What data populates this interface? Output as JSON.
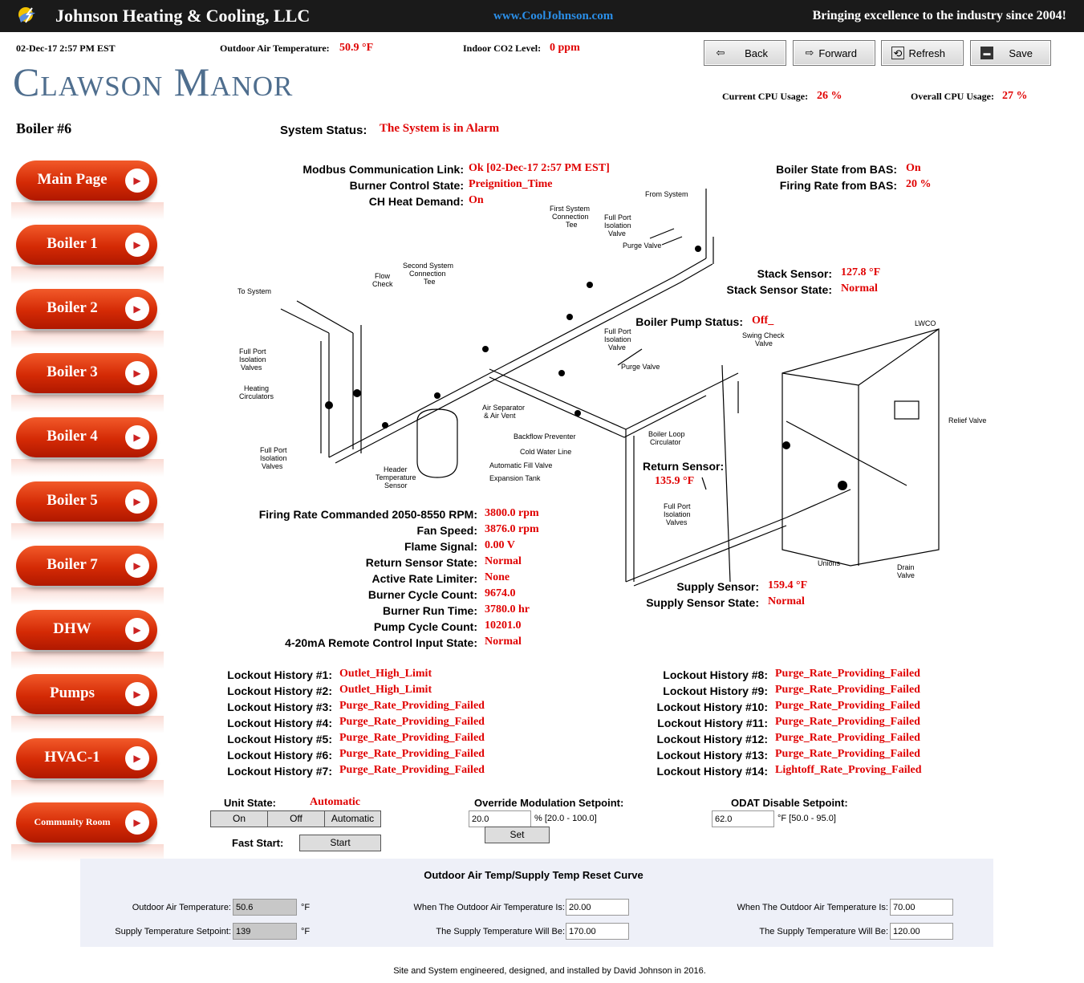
{
  "header": {
    "company": "Johnson Heating & Cooling, LLC",
    "url": "www.CoolJohnson.com",
    "slogan": "Bringing excellence to the industry since 2004!"
  },
  "info": {
    "datetime": "02-Dec-17 2:57 PM EST",
    "oat_label": "Outdoor Air Temperature:",
    "oat_value": "50.9 °F",
    "co2_label": "Indoor CO2 Level:",
    "co2_value": "0 ppm",
    "cpu_label": "Current CPU Usage:",
    "cpu_value": "26 %",
    "ocpu_label": "Overall CPU Usage:",
    "ocpu_value": "27 %"
  },
  "site_title": "Clawson Manor",
  "toolbar": {
    "back": "Back",
    "forward": "Forward",
    "refresh": "Refresh",
    "save": "Save"
  },
  "page_title": "Boiler #6",
  "nav": [
    "Main Page",
    "Boiler 1",
    "Boiler 2",
    "Boiler 3",
    "Boiler 4",
    "Boiler 5",
    "Boiler 7",
    "DHW",
    "Pumps",
    "HVAC-1",
    "Community Room"
  ],
  "status": {
    "label": "System Status:",
    "value": "The System is in Alarm"
  },
  "top_rows": [
    {
      "label": "Modbus Communication Link:",
      "value": "Ok [02-Dec-17 2:57 PM EST]"
    },
    {
      "label": "Burner Control State:",
      "value": "Preignition_Time"
    },
    {
      "label": "CH Heat Demand:",
      "value": "On"
    }
  ],
  "bas": [
    {
      "label": "Boiler State from BAS:",
      "value": "On"
    },
    {
      "label": "Firing Rate from BAS:",
      "value": "20 %"
    }
  ],
  "stack": [
    {
      "label": "Stack Sensor:",
      "value": "127.8 °F"
    },
    {
      "label": "Stack Sensor State:",
      "value": "Normal"
    }
  ],
  "pump": {
    "label": "Boiler Pump Status:",
    "value": "Off_"
  },
  "return_sensor": {
    "label": "Return Sensor:",
    "value": "135.9 °F"
  },
  "supply": [
    {
      "label": "Supply Sensor:",
      "value": "159.4 °F"
    },
    {
      "label": "Supply Sensor State:",
      "value": "Normal"
    }
  ],
  "mid_rows": [
    {
      "label": "Firing Rate Commanded 2050-8550 RPM:",
      "value": "3800.0 rpm"
    },
    {
      "label": "Fan Speed:",
      "value": "3876.0 rpm"
    },
    {
      "label": "Flame Signal:",
      "value": "0.00 V"
    },
    {
      "label": "Return Sensor State:",
      "value": "Normal"
    },
    {
      "label": "Active Rate Limiter:",
      "value": "None"
    },
    {
      "label": "Burner Cycle Count:",
      "value": "9674.0"
    },
    {
      "label": "Burner Run Time:",
      "value": "3780.0 hr"
    },
    {
      "label": "Pump Cycle Count:",
      "value": "10201.0"
    },
    {
      "label": "4-20mA Remote Control Input State:",
      "value": "Normal"
    }
  ],
  "lockouts_left": [
    {
      "label": "Lockout History #1:",
      "value": "Outlet_High_Limit"
    },
    {
      "label": "Lockout History #2:",
      "value": "Outlet_High_Limit"
    },
    {
      "label": "Lockout History #3:",
      "value": "Purge_Rate_Providing_Failed"
    },
    {
      "label": "Lockout History #4:",
      "value": "Purge_Rate_Providing_Failed"
    },
    {
      "label": "Lockout History #5:",
      "value": "Purge_Rate_Providing_Failed"
    },
    {
      "label": "Lockout History #6:",
      "value": "Purge_Rate_Providing_Failed"
    },
    {
      "label": "Lockout History #7:",
      "value": "Purge_Rate_Providing_Failed"
    }
  ],
  "lockouts_right": [
    {
      "label": "Lockout History #8:",
      "value": "Purge_Rate_Providing_Failed"
    },
    {
      "label": "Lockout History #9:",
      "value": "Purge_Rate_Providing_Failed"
    },
    {
      "label": "Lockout History #10:",
      "value": "Purge_Rate_Providing_Failed"
    },
    {
      "label": "Lockout History #11:",
      "value": "Purge_Rate_Providing_Failed"
    },
    {
      "label": "Lockout History #12:",
      "value": "Purge_Rate_Providing_Failed"
    },
    {
      "label": "Lockout History #13:",
      "value": "Purge_Rate_Providing_Failed"
    },
    {
      "label": "Lockout History #14:",
      "value": "Lightoff_Rate_Proving_Failed"
    }
  ],
  "controls": {
    "unit_state_label": "Unit State:",
    "unit_state_value": "Automatic",
    "on": "On",
    "off": "Off",
    "automatic": "Automatic",
    "fast_start_label": "Fast Start:",
    "start": "Start",
    "override_label": "Override Modulation Setpoint:",
    "override_value": "20.0",
    "override_range": "% [20.0 - 100.0]",
    "set": "Set",
    "odat_label": "ODAT Disable Setpoint:",
    "odat_value": "62.0",
    "odat_range": "°F [50.0 - 95.0]"
  },
  "reset": {
    "title": "Outdoor Air Temp/Supply Temp Reset Curve",
    "oat_label": "Outdoor Air Temperature:",
    "oat_value": "50.6",
    "unit": "°F",
    "sts_label": "Supply Temperature Setpoint:",
    "sts_value": "139",
    "w1_label": "When The Outdoor Air Temperature Is:",
    "w1_value": "20.00",
    "s1_label": "The Supply Temperature Will Be:",
    "s1_value": "170.00",
    "w2_label": "When The Outdoor Air Temperature Is:",
    "w2_value": "70.00",
    "s2_label": "The Supply Temperature Will Be:",
    "s2_value": "120.00"
  },
  "diagram": {
    "from_system": "From System",
    "first_tee_1": "First System",
    "first_tee_2": "Connection",
    "first_tee_3": "Tee",
    "fp_top_1": "Full Port",
    "fp_top_2": "Isolation",
    "fp_top_3": "Valve",
    "purge_top": "Purge Valve",
    "second_tee_1": "Second System",
    "second_tee_2": "Connection",
    "second_tee_3": "Tee",
    "to_system": "To System",
    "flow_1": "Flow",
    "flow_2": "Check",
    "fpv_l_1": "Full Port",
    "fpv_l_2": "Isolation",
    "fpv_l_3": "Valves",
    "heat_circ_1": "Heating",
    "heat_circ_2": "Circulators",
    "fpv_b_1": "Full Port",
    "fpv_b_2": "Isolation",
    "fpv_b_3": "Valves",
    "header_1": "Header",
    "header_2": "Temperature",
    "header_3": "Sensor",
    "air_sep_1": "Air Separator",
    "air_sep_2": "& Air Vent",
    "backflow": "Backflow Preventer",
    "cold_water": "Cold Water Line",
    "auto_fill": "Automatic Fill Valve",
    "exp_tank": "Expansion Tank",
    "fp_mid_1": "Full Port",
    "fp_mid_2": "Isolation",
    "fp_mid_3": "Valve",
    "purge_mid": "Purge Valve",
    "swing_1": "Swing Check",
    "swing_2": "Valve",
    "loop_1": "Boiler Loop",
    "loop_2": "Circulator",
    "lwco": "LWCO",
    "relief": "Relief Valve",
    "fpv_r_1": "Full Port",
    "fpv_r_2": "Isolation",
    "fpv_r_3": "Valves",
    "unions": "Unions",
    "drain_1": "Drain",
    "drain_2": "Valve"
  },
  "footer": "Site and System engineered, designed, and installed by David Johnson in 2016."
}
